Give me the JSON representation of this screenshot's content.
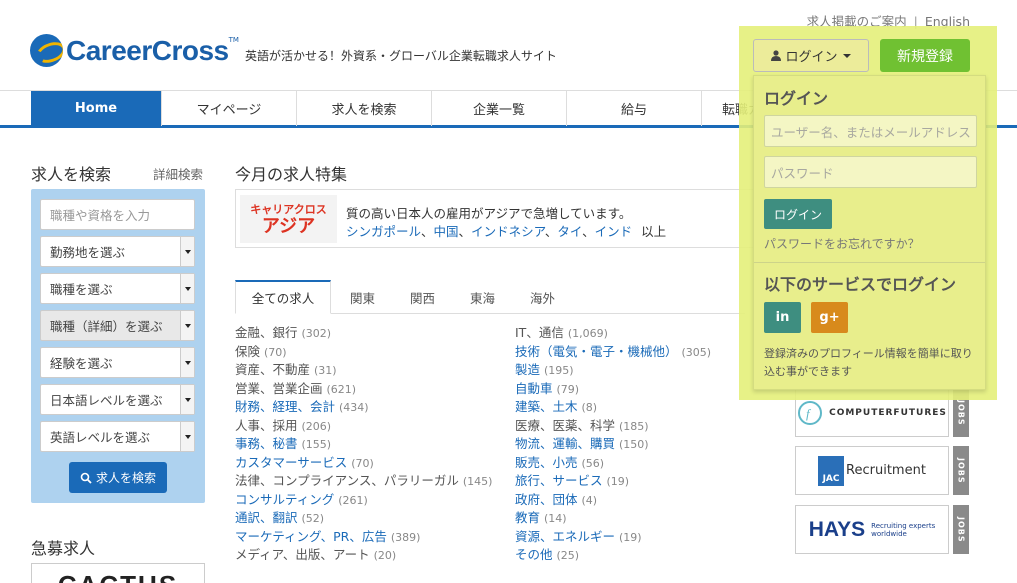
{
  "header": {
    "links": {
      "post_jobs": "求人掲載のご案内",
      "separator": "|",
      "english": "English"
    },
    "logo_text": "CareerCross",
    "logo_tm": "TM",
    "tagline": "英語が活かせる！外資系・グローバル企業転職求人サイト",
    "login_button": "ログイン",
    "register_button": "新規登録"
  },
  "nav": {
    "items": [
      "Home",
      "マイページ",
      "求人を検索",
      "企業一覧",
      "給与",
      "転職ガ"
    ]
  },
  "search": {
    "heading": "求人を検索",
    "detail_link": "詳細検索",
    "keyword_placeholder": "職種や資格を入力",
    "selects": [
      "勤務地を選ぶ",
      "職種を選ぶ",
      "職種（詳細）を選ぶ",
      "経験を選ぶ",
      "日本語レベルを選ぶ",
      "英語レベルを選ぶ"
    ],
    "button": "求人を検索"
  },
  "urgent": {
    "heading": "急募求人",
    "logo": "CACTUS"
  },
  "feature": {
    "heading": "今月の求人特集",
    "banner_logo_top": "キャリアクロス",
    "banner_logo_bottom": "アジア",
    "line1": "質の高い日本人の雇用がアジアで急増しています。",
    "countries": [
      "シンガポール",
      "中国",
      "インドネシア",
      "タイ",
      "インド"
    ],
    "country_sep": "、",
    "more": "以上"
  },
  "tabs": [
    "全ての求人",
    "関東",
    "関西",
    "東海",
    "海外"
  ],
  "categories_left": [
    {
      "label": "金融、銀行",
      "count": "(302)",
      "link": false
    },
    {
      "label": "保険",
      "count": "(70)",
      "link": false
    },
    {
      "label": "資産、不動産",
      "count": "(31)",
      "link": false
    },
    {
      "label": "営業、営業企画",
      "count": "(621)",
      "link": false
    },
    {
      "label": "財務、経理、会計",
      "count": "(434)",
      "link": true
    },
    {
      "label": "人事、採用",
      "count": "(206)",
      "link": false
    },
    {
      "label": "事務、秘書",
      "count": "(155)",
      "link": true
    },
    {
      "label": "カスタマーサービス",
      "count": "(70)",
      "link": true
    },
    {
      "label": "法律、コンプライアンス、パラリーガル",
      "count": "(145)",
      "link": false
    },
    {
      "label": "コンサルティング",
      "count": "(261)",
      "link": true
    },
    {
      "label": "通訳、翻訳",
      "count": "(52)",
      "link": true
    },
    {
      "label": "マーケティング、PR、広告",
      "count": "(389)",
      "link": true
    },
    {
      "label": "メディア、出版、アート",
      "count": "(20)",
      "link": false
    }
  ],
  "categories_right": [
    {
      "label": "IT、通信",
      "count": "(1,069)",
      "link": false
    },
    {
      "label": "技術（電気・電子・機械他）",
      "count": "(305)",
      "link": true
    },
    {
      "label": "製造",
      "count": "(195)",
      "link": true
    },
    {
      "label": "自動車",
      "count": "(79)",
      "link": true
    },
    {
      "label": "建築、土木",
      "count": "(8)",
      "link": true
    },
    {
      "label": "医療、医薬、科学",
      "count": "(185)",
      "link": false
    },
    {
      "label": "物流、運輸、購買",
      "count": "(150)",
      "link": true
    },
    {
      "label": "販売、小売",
      "count": "(56)",
      "link": true
    },
    {
      "label": "旅行、サービス",
      "count": "(19)",
      "link": true
    },
    {
      "label": "政府、団体",
      "count": "(4)",
      "link": true
    },
    {
      "label": "教育",
      "count": "(14)",
      "link": true
    },
    {
      "label": "資源、エネルギー",
      "count": "(19)",
      "link": true
    },
    {
      "label": "その他",
      "count": "(25)",
      "link": true
    }
  ],
  "partners": [
    {
      "name": "COMPUTERFUTURES",
      "tag": "JOBS"
    },
    {
      "name": "Recruitment",
      "prefix": "JAC",
      "tag": "JOBS"
    },
    {
      "name": "HAYS",
      "sub1": "Recruiting experts",
      "sub2": "worldwide",
      "tag": "JOBS"
    }
  ],
  "login_panel": {
    "title": "ログイン",
    "username_placeholder": "ユーザー名、またはメールアドレス",
    "password_placeholder": "パスワード",
    "submit": "ログイン",
    "forgot": "パスワードをお忘れですか？",
    "social_title": "以下のサービスでログイン",
    "linkedin": "in",
    "google": "g+",
    "note": "登録済みのプロフィール情報を簡単に取り込む事ができます"
  },
  "colors": {
    "brand_blue": "#1a6ab8",
    "register_green": "#70c132",
    "highlight": "#e4f07a",
    "search_bg": "#aed2ef",
    "linkedin": "#3e8e80",
    "google": "#d88a1c"
  }
}
